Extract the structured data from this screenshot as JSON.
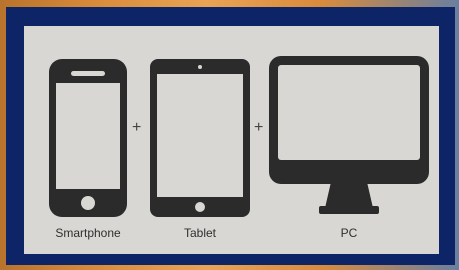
{
  "devices": [
    {
      "label": "Smartphone",
      "icon": "smartphone-icon"
    },
    {
      "label": "Tablet",
      "icon": "tablet-icon"
    },
    {
      "label": "PC",
      "icon": "monitor-icon"
    }
  ],
  "separators": [
    "+",
    "+"
  ],
  "colors": {
    "frame": "#0d2466",
    "panel": "#d9d7d3",
    "device": "#2b2b2b",
    "screen": "#d9d7d3"
  }
}
